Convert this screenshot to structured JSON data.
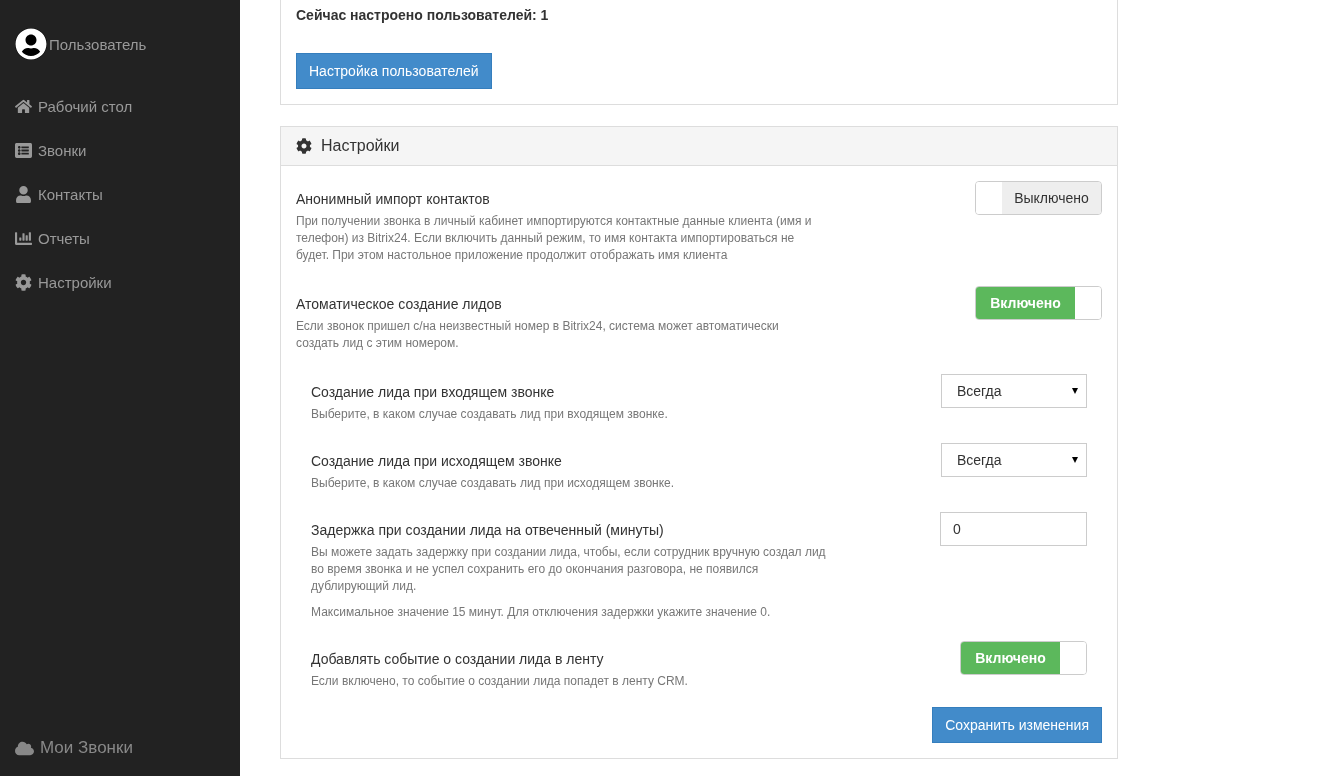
{
  "sidebar": {
    "user": "Пользователь",
    "items": [
      {
        "label": "Рабочий стол",
        "selected": false
      },
      {
        "label": "Звонки",
        "selected": false
      },
      {
        "label": "Контакты",
        "selected": false
      },
      {
        "label": "Отчеты",
        "selected": false
      },
      {
        "label": "Настройки",
        "selected": false
      }
    ],
    "footer": "Мои Звонки"
  },
  "users_panel": {
    "count_text": "Сейчас настроено пользователей: 1",
    "button": "Настройка пользователей"
  },
  "settings_panel": {
    "title": "Настройки",
    "items": [
      {
        "kind": "toggle",
        "label": "Анонимный импорт контактов",
        "description": "При получении звонка в личный кабинет импортируются контактные данные клиента (имя и телефон) из Bitrix24. Если включить данный режим, то имя контакта импортироваться не будет. При этом настольное приложение продолжит отображать имя клиента",
        "on": false,
        "state_text": "Выключено"
      },
      {
        "kind": "toggle",
        "label": "Атоматическое создание лидов",
        "description": "Если звонок пришел с/на неизвестный номер в Bitrix24, система может автоматически создать лид с этим номером.",
        "on": true,
        "state_text": "Включено",
        "children": [
          {
            "kind": "select",
            "label": "Создание лида при входящем звонке",
            "description": "Выберите, в каком случае создавать лид при входящем звонке.",
            "value": "Всегда"
          },
          {
            "kind": "select",
            "label": "Создание лида при исходящем звонке",
            "description": "Выберите, в каком случае создавать лид при исходящем звонке.",
            "value": "Всегда"
          },
          {
            "kind": "number",
            "label": "Задержка при создании лида на отвеченный (минуты)",
            "description": "Вы можете задать задержку при создании лида, чтобы, если сотрудник вручную создал лид во время звонка и не успел сохранить его до окончания разговора, не появился дублирующий лид.",
            "note": "Максимальное значение 15 минут. Для отключения задержки укажите значение 0.",
            "value": "0"
          },
          {
            "kind": "toggle",
            "label": "Добавлять событие о создании лида в ленту",
            "description": "Если включено, то событие о создании лида попадет в ленту CRM.",
            "on": true,
            "state_text": "Включено"
          }
        ]
      }
    ],
    "save_button": "Сохранить изменения"
  }
}
